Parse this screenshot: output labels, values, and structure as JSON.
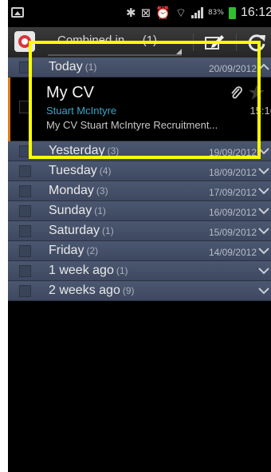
{
  "status_bar": {
    "icons": [
      "notification-icon",
      "bluetooth-icon",
      "mute-icon",
      "alarm-icon",
      "wifi-icon",
      "signal-icon"
    ],
    "battery_percent": "83%",
    "time": "16:12",
    "colors": {
      "battery": "#2ec02e"
    }
  },
  "action_bar": {
    "folder_label": "Combined in...",
    "folder_count": "(1)",
    "compose_icon": "compose-icon",
    "refresh_icon": "refresh-icon"
  },
  "groups": [
    {
      "label": "Today",
      "count": "(1)",
      "date": "20/09/2012",
      "expanded": true
    },
    {
      "label": "Yesterday",
      "count": "(3)",
      "date": "19/09/2012"
    },
    {
      "label": "Tuesday",
      "count": "(4)",
      "date": "18/09/2012"
    },
    {
      "label": "Monday",
      "count": "(3)",
      "date": "17/09/2012"
    },
    {
      "label": "Sunday",
      "count": "(1)",
      "date": "16/09/2012"
    },
    {
      "label": "Saturday",
      "count": "(1)",
      "date": "15/09/2012"
    },
    {
      "label": "Friday",
      "count": "(2)",
      "date": "14/09/2012"
    },
    {
      "label": "1 week ago",
      "count": "(1)",
      "date": ""
    },
    {
      "label": "2 weeks ago",
      "count": "(9)",
      "date": ""
    }
  ],
  "email": {
    "subject": "My CV",
    "sender": "Stuart McIntyre",
    "preview": "My CV Stuart McIntyre Recruitment...",
    "time": "15:16",
    "has_attachment": true,
    "colors": {
      "sender": "#3aa6c8",
      "unread_accent": "#e07a12"
    }
  },
  "overlay": {
    "color": "#ffff00"
  }
}
